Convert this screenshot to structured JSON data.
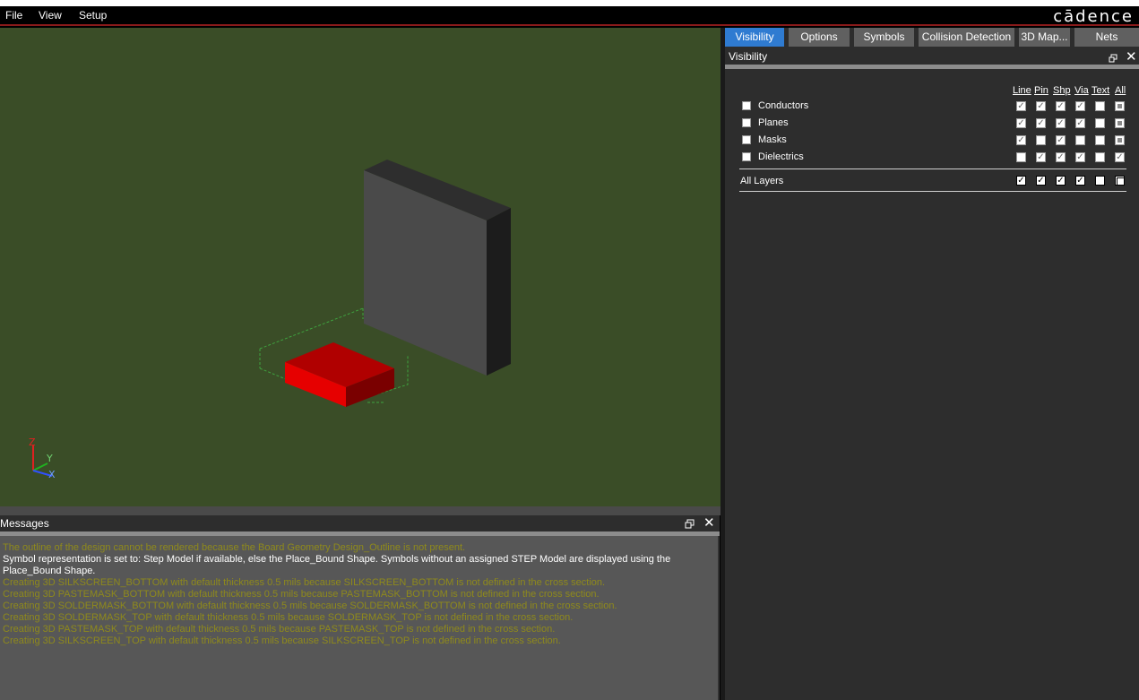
{
  "menu": {
    "items": [
      "File",
      "View",
      "Setup"
    ]
  },
  "brand": "cādence",
  "tabs": [
    "Visibility",
    "Options",
    "Symbols",
    "Collision Detection",
    "3D Map...",
    "Nets"
  ],
  "active_tab": "Visibility",
  "visibility_panel": {
    "title": "Visibility",
    "columns": [
      "Line",
      "Pin",
      "Shp",
      "Via",
      "Text",
      "All"
    ],
    "rows": [
      {
        "label": "Conductors",
        "checked": false,
        "states": [
          "check",
          "check",
          "check",
          "check",
          "empty",
          "partial"
        ]
      },
      {
        "label": "Planes",
        "checked": false,
        "states": [
          "check",
          "check",
          "check",
          "check",
          "empty",
          "partial"
        ]
      },
      {
        "label": "Masks",
        "checked": false,
        "states": [
          "check",
          "empty",
          "check",
          "empty",
          "empty",
          "partial"
        ]
      },
      {
        "label": "Dielectrics",
        "checked": false,
        "states": [
          "empty",
          "check",
          "check",
          "check",
          "empty",
          "check"
        ]
      }
    ],
    "all_layers": {
      "label": "All Layers",
      "states": [
        "check",
        "check",
        "check",
        "check",
        "empty",
        "partial"
      ]
    }
  },
  "axis_labels": {
    "z": "Z",
    "y": "Y",
    "x": "X"
  },
  "messages": {
    "title": "Messages",
    "lines": [
      {
        "text": "The outline of the design cannot be rendered because the Board Geometry Design_Outline is not present.",
        "kind": "warn"
      },
      {
        "text": "Symbol representation is set to: Step Model if available, else the Place_Bound Shape.  Symbols without an assigned STEP Model are displayed using the Place_Bound Shape.",
        "kind": "info"
      },
      {
        "text": "Creating 3D SILKSCREEN_BOTTOM with default thickness 0.5 mils because SILKSCREEN_BOTTOM is not defined in the cross section.",
        "kind": "warn"
      },
      {
        "text": "Creating 3D PASTEMASK_BOTTOM with default thickness 0.5 mils because PASTEMASK_BOTTOM is not defined in the cross section.",
        "kind": "warn"
      },
      {
        "text": "Creating 3D SOLDERMASK_BOTTOM with default thickness 0.5 mils because SOLDERMASK_BOTTOM is not defined in the cross section.",
        "kind": "warn"
      },
      {
        "text": "Creating 3D SOLDERMASK_TOP with default thickness 0.5 mils because SOLDERMASK_TOP is not defined in the cross section.",
        "kind": "warn"
      },
      {
        "text": "Creating 3D PASTEMASK_TOP with default thickness 0.5 mils because PASTEMASK_TOP is not defined in the cross section.",
        "kind": "warn"
      },
      {
        "text": "Creating 3D SILKSCREEN_TOP with default thickness 0.5 mils because SILKSCREEN_TOP is not defined in the cross section.",
        "kind": "warn"
      }
    ]
  },
  "colors": {
    "viewport": "#3a4d27",
    "active_tab": "#2f7bd1",
    "warn_text": "#8f8a1b",
    "red_part": "#cc0000"
  }
}
